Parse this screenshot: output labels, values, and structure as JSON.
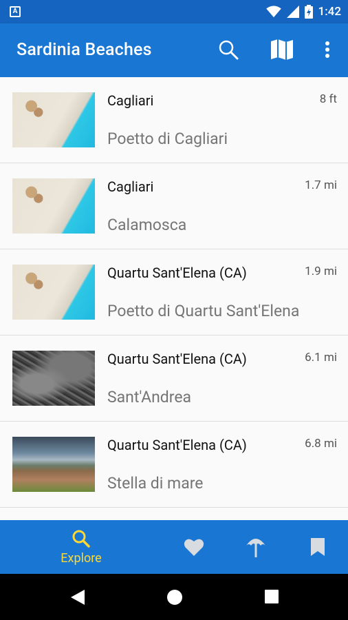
{
  "status_bar": {
    "time": "1:42",
    "left_icon": "A"
  },
  "app_bar": {
    "title": "Sardinia Beaches"
  },
  "beaches": [
    {
      "city": "Cagliari",
      "distance": "8 ft",
      "name": "Poetto di Cagliari",
      "thumb": "beach"
    },
    {
      "city": "Cagliari",
      "distance": "1.7 mi",
      "name": "Calamosca",
      "thumb": "beach"
    },
    {
      "city": "Quartu Sant'Elena (CA)",
      "distance": "1.9 mi",
      "name": "Poetto di Quartu Sant'Elena",
      "thumb": "beach"
    },
    {
      "city": "Quartu Sant'Elena (CA)",
      "distance": "6.1 mi",
      "name": "Sant'Andrea",
      "thumb": "gravel"
    },
    {
      "city": "Quartu Sant'Elena (CA)",
      "distance": "6.8 mi",
      "name": "Stella di mare",
      "thumb": "coast"
    }
  ],
  "bottom_nav": {
    "explore_label": "Explore"
  },
  "colors": {
    "primary": "#1976d2",
    "status": "#1565c0",
    "accent": "#fdd835"
  }
}
